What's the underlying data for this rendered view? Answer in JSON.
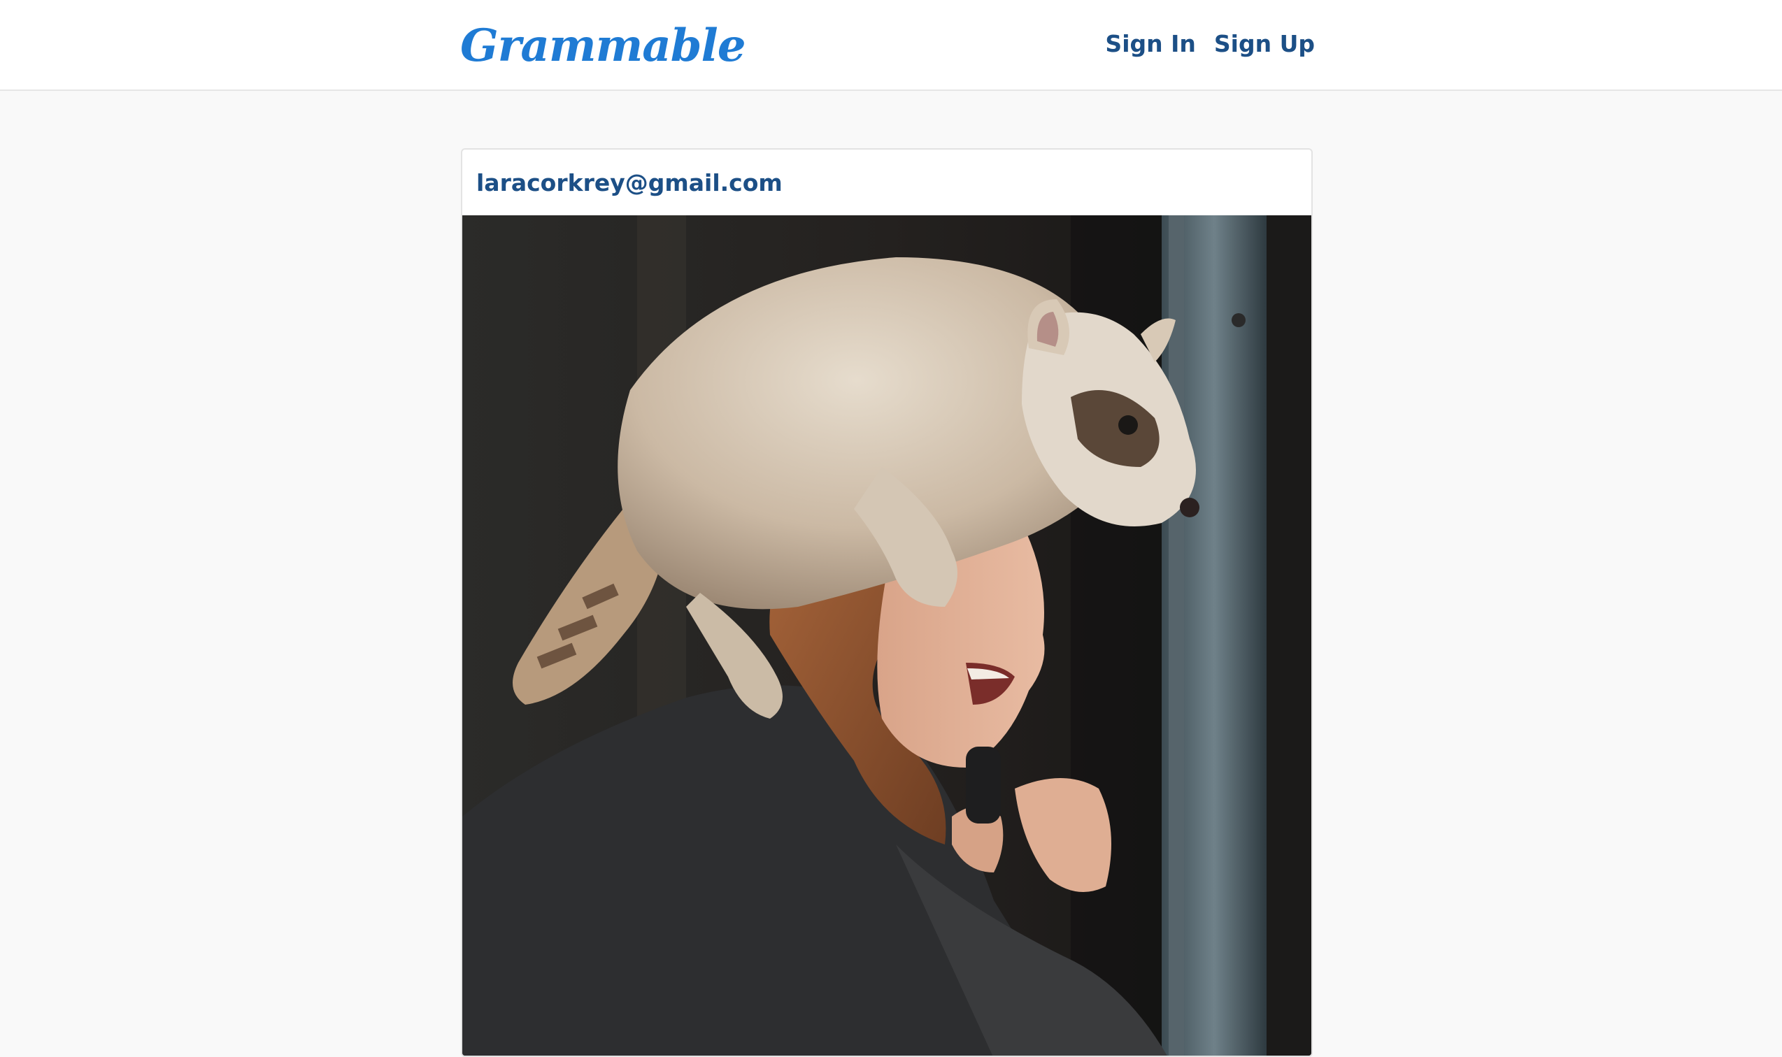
{
  "app": {
    "brand": "Grammable"
  },
  "nav": {
    "links": [
      "Sign In",
      "Sign Up"
    ]
  },
  "post": {
    "author": "laracorkrey@gmail.com",
    "image_alt": "Raccoon perched on the shoulders of a laughing woman beside a window"
  },
  "colors": {
    "brand": "#1f7bd4",
    "link": "#1c4f86",
    "page_bg": "#f9f9f9"
  }
}
